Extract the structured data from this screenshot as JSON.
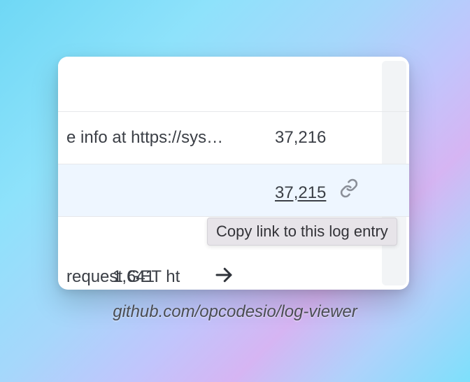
{
  "rows": [
    {
      "message": "e info at https://sys…",
      "number": "37,216"
    },
    {
      "message": "",
      "number": "37,215"
    },
    {
      "message": "request GET   ht",
      "number": "1,641"
    }
  ],
  "tooltip": "Copy link to this log entry",
  "caption": "github.com/opcodesio/log-viewer",
  "icons": {
    "link": "link-icon",
    "arrow": "arrow-right-icon"
  }
}
